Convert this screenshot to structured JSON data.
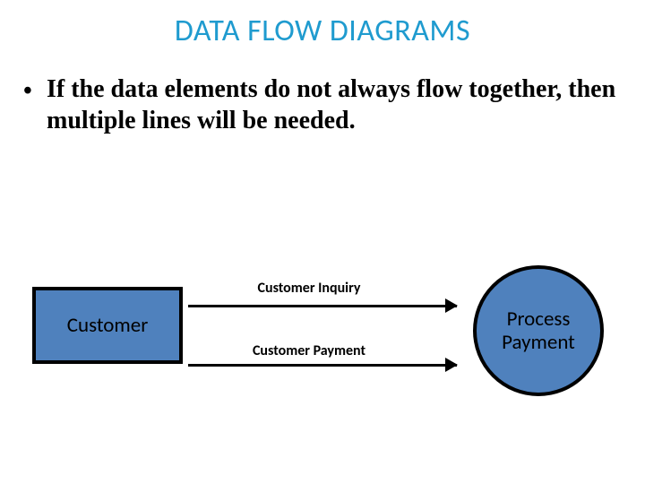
{
  "title": "DATA FLOW DIAGRAMS",
  "bullet": "If the data elements do not always flow together, then multiple lines will be needed.",
  "entity": {
    "label": "Customer"
  },
  "flows": {
    "top": "Customer Inquiry",
    "bottom": "Customer Payment"
  },
  "process": {
    "label": "Process\nPayment"
  },
  "colors": {
    "accent": "#1f9bcf",
    "shape_fill": "#4f81bd",
    "shape_border": "#000000"
  }
}
